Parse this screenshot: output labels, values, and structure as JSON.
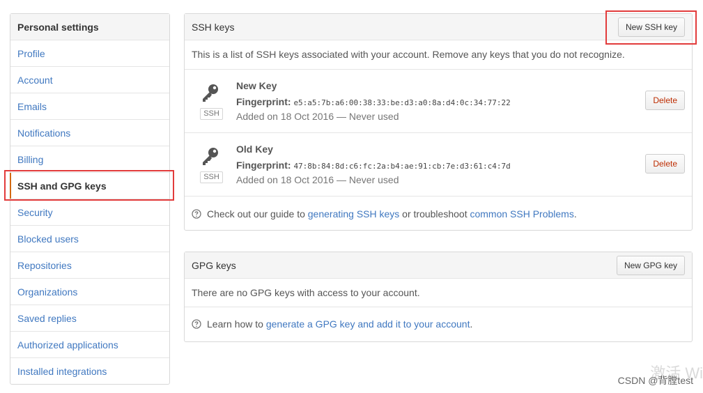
{
  "sidebar": {
    "heading": "Personal settings",
    "items": [
      {
        "label": "Profile"
      },
      {
        "label": "Account"
      },
      {
        "label": "Emails"
      },
      {
        "label": "Notifications"
      },
      {
        "label": "Billing"
      },
      {
        "label": "SSH and GPG keys",
        "selected": true
      },
      {
        "label": "Security"
      },
      {
        "label": "Blocked users"
      },
      {
        "label": "Repositories"
      },
      {
        "label": "Organizations"
      },
      {
        "label": "Saved replies"
      },
      {
        "label": "Authorized applications"
      },
      {
        "label": "Installed integrations"
      }
    ]
  },
  "ssh": {
    "title": "SSH keys",
    "new_button": "New SSH key",
    "description": "This is a list of SSH keys associated with your account. Remove any keys that you do not recognize.",
    "keys": [
      {
        "name": "New Key",
        "badge": "SSH",
        "fingerprint_label": "Fingerprint:",
        "fingerprint": "e5:a5:7b:a6:00:38:33:be:d3:a0:8a:d4:0c:34:77:22",
        "added": "Added on 18 Oct 2016 — Never used",
        "delete_label": "Delete"
      },
      {
        "name": "Old Key",
        "badge": "SSH",
        "fingerprint_label": "Fingerprint:",
        "fingerprint": "47:8b:84:8d:c6:fc:2a:b4:ae:91:cb:7e:d3:61:c4:7d",
        "added": "Added on 18 Oct 2016 — Never used",
        "delete_label": "Delete"
      }
    ],
    "help": {
      "prefix": "Check out our guide to ",
      "link1": "generating SSH keys",
      "middle": " or troubleshoot ",
      "link2": "common SSH Problems",
      "suffix": "."
    }
  },
  "gpg": {
    "title": "GPG keys",
    "new_button": "New GPG key",
    "empty": "There are no GPG keys with access to your account.",
    "help": {
      "prefix": "Learn how to ",
      "link": "generate a GPG key and add it to your account",
      "suffix": "."
    }
  },
  "watermark": "CSDN @背膛test",
  "watermark_bg": "激活 Wi",
  "colors": {
    "link": "#4078c0",
    "selected_accent": "#d26911",
    "delete": "#bd2c00",
    "highlight": "#e23b3b"
  }
}
